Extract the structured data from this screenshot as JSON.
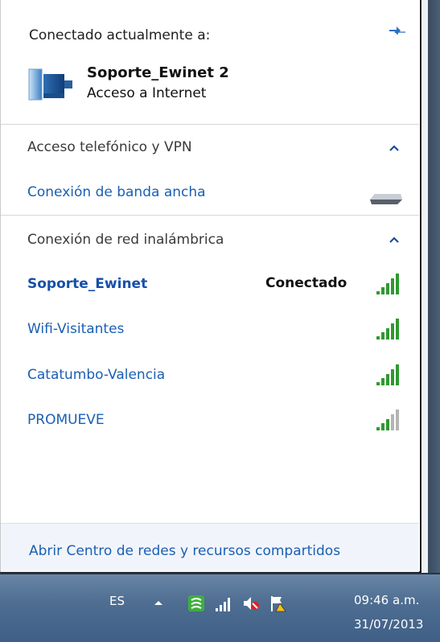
{
  "current": {
    "header": "Conectado actualmente a:",
    "network_name": "Soporte_Ewinet  2",
    "network_status": "Acceso a Internet"
  },
  "dialup": {
    "title": "Acceso telefónico y VPN",
    "items": [
      {
        "label": "Conexión de banda ancha"
      }
    ]
  },
  "wireless": {
    "title": "Conexión de red inalámbrica",
    "networks": [
      {
        "name": "Soporte_Ewinet",
        "status": "Conectado",
        "signal": 5
      },
      {
        "name": "Wifi-Visitantes",
        "status": "",
        "signal": 5
      },
      {
        "name": "Catatumbo-Valencia",
        "status": "",
        "signal": 5
      },
      {
        "name": "PROMUEVE",
        "status": "",
        "signal": 3
      }
    ]
  },
  "footer": {
    "link": "Abrir Centro de redes y recursos compartidos"
  },
  "taskbar": {
    "language": "ES",
    "time": "09:46 a.m.",
    "date": "31/07/2013",
    "tray_icons": [
      "show-hidden-icons",
      "network-app-icon",
      "wifi-signal-icon",
      "volume-muted-icon",
      "action-center-flag-icon"
    ]
  },
  "colors": {
    "link": "#1a5fb4",
    "signal_green": "#2f9a2f",
    "signal_grey": "#b5b5b5",
    "taskbar": "#4f6e92"
  }
}
